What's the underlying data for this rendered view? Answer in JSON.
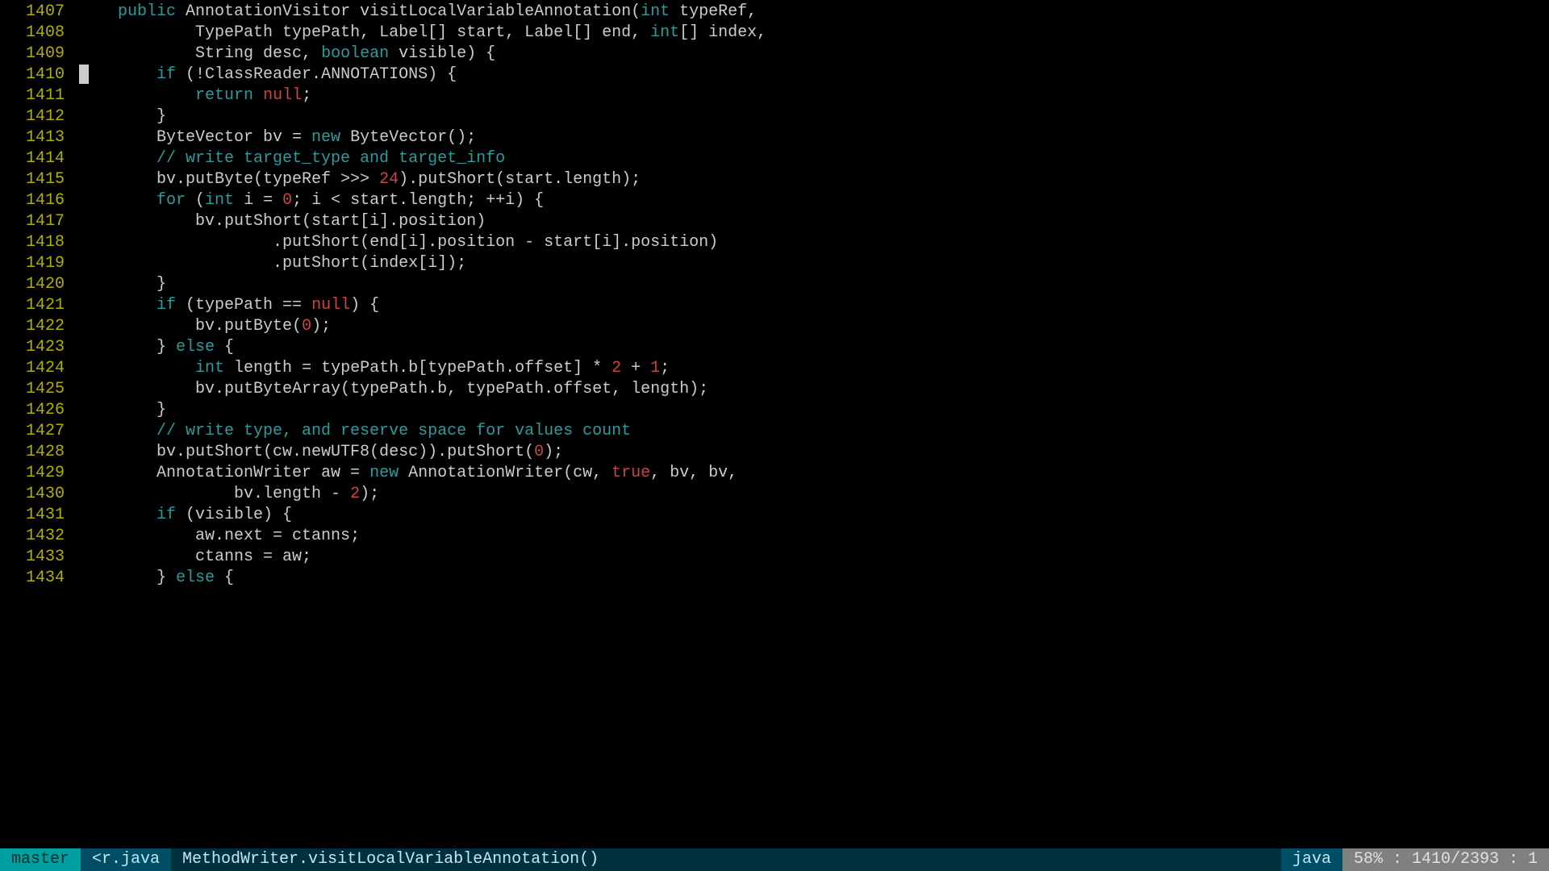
{
  "gutter_start": 1407,
  "current_line": 1410,
  "lines": [
    {
      "indent": "    ",
      "tokens": [
        {
          "c": "kw",
          "t": "public"
        },
        {
          "t": " AnnotationVisitor visitLocalVariableAnnotation("
        },
        {
          "c": "typekw",
          "t": "int"
        },
        {
          "t": " typeRef,"
        }
      ]
    },
    {
      "indent": "            ",
      "tokens": [
        {
          "t": "TypePath typePath, Label[] start, Label[] end, "
        },
        {
          "c": "typekw",
          "t": "int"
        },
        {
          "t": "[] index,"
        }
      ]
    },
    {
      "indent": "            ",
      "tokens": [
        {
          "t": "String desc, "
        },
        {
          "c": "typekw",
          "t": "boolean"
        },
        {
          "t": " visible) {"
        }
      ]
    },
    {
      "indent": "",
      "cursor_lead": true,
      "tokens": [
        {
          "t": "       "
        },
        {
          "c": "kw",
          "t": "if"
        },
        {
          "t": " (!ClassReader.ANNOTATIONS) {"
        }
      ]
    },
    {
      "indent": "            ",
      "tokens": [
        {
          "c": "kw",
          "t": "return"
        },
        {
          "t": " "
        },
        {
          "c": "bool",
          "t": "null"
        },
        {
          "t": ";"
        }
      ]
    },
    {
      "indent": "        ",
      "tokens": [
        {
          "t": "}"
        }
      ]
    },
    {
      "indent": "        ",
      "tokens": [
        {
          "t": "ByteVector bv = "
        },
        {
          "c": "kw",
          "t": "new"
        },
        {
          "t": " ByteVector();"
        }
      ]
    },
    {
      "indent": "        ",
      "tokens": [
        {
          "c": "cmt",
          "t": "// write target_type and target_info"
        }
      ]
    },
    {
      "indent": "        ",
      "tokens": [
        {
          "t": "bv.putByte(typeRef >>> "
        },
        {
          "c": "num",
          "t": "24"
        },
        {
          "t": ").putShort(start.length);"
        }
      ]
    },
    {
      "indent": "        ",
      "tokens": [
        {
          "c": "kw",
          "t": "for"
        },
        {
          "t": " ("
        },
        {
          "c": "typekw",
          "t": "int"
        },
        {
          "t": " i = "
        },
        {
          "c": "num",
          "t": "0"
        },
        {
          "t": "; i < start.length; ++i) {"
        }
      ]
    },
    {
      "indent": "            ",
      "tokens": [
        {
          "t": "bv.putShort(start[i].position)"
        }
      ]
    },
    {
      "indent": "                    ",
      "tokens": [
        {
          "t": ".putShort(end[i].position - start[i].position)"
        }
      ]
    },
    {
      "indent": "                    ",
      "tokens": [
        {
          "t": ".putShort(index[i]);"
        }
      ]
    },
    {
      "indent": "        ",
      "tokens": [
        {
          "t": "}"
        }
      ]
    },
    {
      "indent": "        ",
      "tokens": [
        {
          "c": "kw",
          "t": "if"
        },
        {
          "t": " (typePath == "
        },
        {
          "c": "bool",
          "t": "null"
        },
        {
          "t": ") {"
        }
      ]
    },
    {
      "indent": "            ",
      "tokens": [
        {
          "t": "bv.putByte("
        },
        {
          "c": "num",
          "t": "0"
        },
        {
          "t": ");"
        }
      ]
    },
    {
      "indent": "        ",
      "tokens": [
        {
          "t": "} "
        },
        {
          "c": "kw",
          "t": "else"
        },
        {
          "t": " {"
        }
      ]
    },
    {
      "indent": "            ",
      "tokens": [
        {
          "c": "typekw",
          "t": "int"
        },
        {
          "t": " length = typePath.b[typePath.offset] * "
        },
        {
          "c": "num",
          "t": "2"
        },
        {
          "t": " + "
        },
        {
          "c": "num",
          "t": "1"
        },
        {
          "t": ";"
        }
      ]
    },
    {
      "indent": "            ",
      "tokens": [
        {
          "t": "bv.putByteArray(typePath.b, typePath.offset, length);"
        }
      ]
    },
    {
      "indent": "        ",
      "tokens": [
        {
          "t": "}"
        }
      ]
    },
    {
      "indent": "        ",
      "tokens": [
        {
          "c": "cmt",
          "t": "// write type, and reserve space for values count"
        }
      ]
    },
    {
      "indent": "        ",
      "tokens": [
        {
          "t": "bv.putShort(cw.newUTF8(desc)).putShort("
        },
        {
          "c": "num",
          "t": "0"
        },
        {
          "t": ");"
        }
      ]
    },
    {
      "indent": "        ",
      "tokens": [
        {
          "t": "AnnotationWriter aw = "
        },
        {
          "c": "kw",
          "t": "new"
        },
        {
          "t": " AnnotationWriter(cw, "
        },
        {
          "c": "bool",
          "t": "true"
        },
        {
          "t": ", bv, bv,"
        }
      ]
    },
    {
      "indent": "                ",
      "tokens": [
        {
          "t": "bv.length - "
        },
        {
          "c": "num",
          "t": "2"
        },
        {
          "t": ");"
        }
      ]
    },
    {
      "indent": "        ",
      "tokens": [
        {
          "c": "kw",
          "t": "if"
        },
        {
          "t": " (visible) {"
        }
      ]
    },
    {
      "indent": "            ",
      "tokens": [
        {
          "t": "aw.next = ctanns;"
        }
      ]
    },
    {
      "indent": "            ",
      "tokens": [
        {
          "t": "ctanns = aw;"
        }
      ]
    },
    {
      "indent": "        ",
      "tokens": [
        {
          "t": "} "
        },
        {
          "c": "kw",
          "t": "else"
        },
        {
          "t": " {"
        }
      ]
    }
  ],
  "status": {
    "branch": "master",
    "file": "<r.java",
    "func": "MethodWriter.visitLocalVariableAnnotation()",
    "filetype": "java",
    "position": "58% : 1410/2393 : 1"
  }
}
